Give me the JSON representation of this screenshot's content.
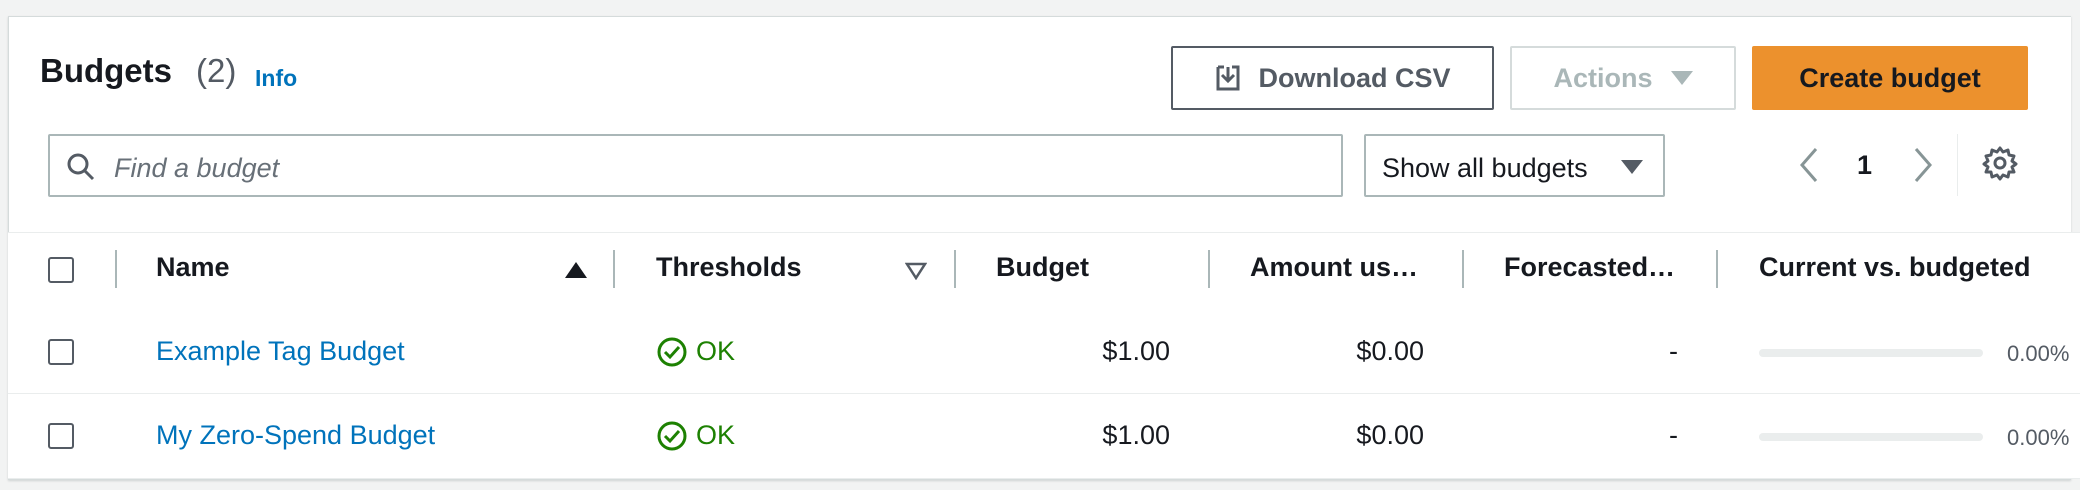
{
  "header": {
    "title": "Budgets",
    "count": "(2)",
    "info_link": "Info",
    "download_label": "Download CSV",
    "actions_label": "Actions",
    "create_label": "Create budget"
  },
  "filters": {
    "search_placeholder": "Find a budget",
    "select_value": "Show all budgets"
  },
  "pagination": {
    "current_page": "1"
  },
  "table": {
    "columns": [
      "Name",
      "Thresholds",
      "Budget",
      "Amount us…",
      "Forecasted…",
      "Current vs. budgeted"
    ],
    "sorted_column": "Name",
    "sort_direction": "ascending",
    "rows": [
      {
        "name": "Example Tag Budget",
        "threshold": "OK",
        "budget": "$1.00",
        "amount_used": "$0.00",
        "forecasted": "-",
        "current_vs_budgeted": "0.00%",
        "progress_fraction": 0
      },
      {
        "name": "My Zero-Spend Budget",
        "threshold": "OK",
        "budget": "$1.00",
        "amount_used": "$0.00",
        "forecasted": "-",
        "current_vs_budgeted": "0.00%",
        "progress_fraction": 0
      }
    ]
  },
  "icons": {
    "download": "download-icon",
    "caret": "caret-down-icon",
    "search": "search-icon",
    "prev": "chevron-left-icon",
    "next": "chevron-right-icon",
    "settings": "gear-icon",
    "status_ok": "check-circle-icon"
  },
  "colors": {
    "primary_button": "#ec912d",
    "link": "#0073bb",
    "status_ok": "#1d8102"
  }
}
